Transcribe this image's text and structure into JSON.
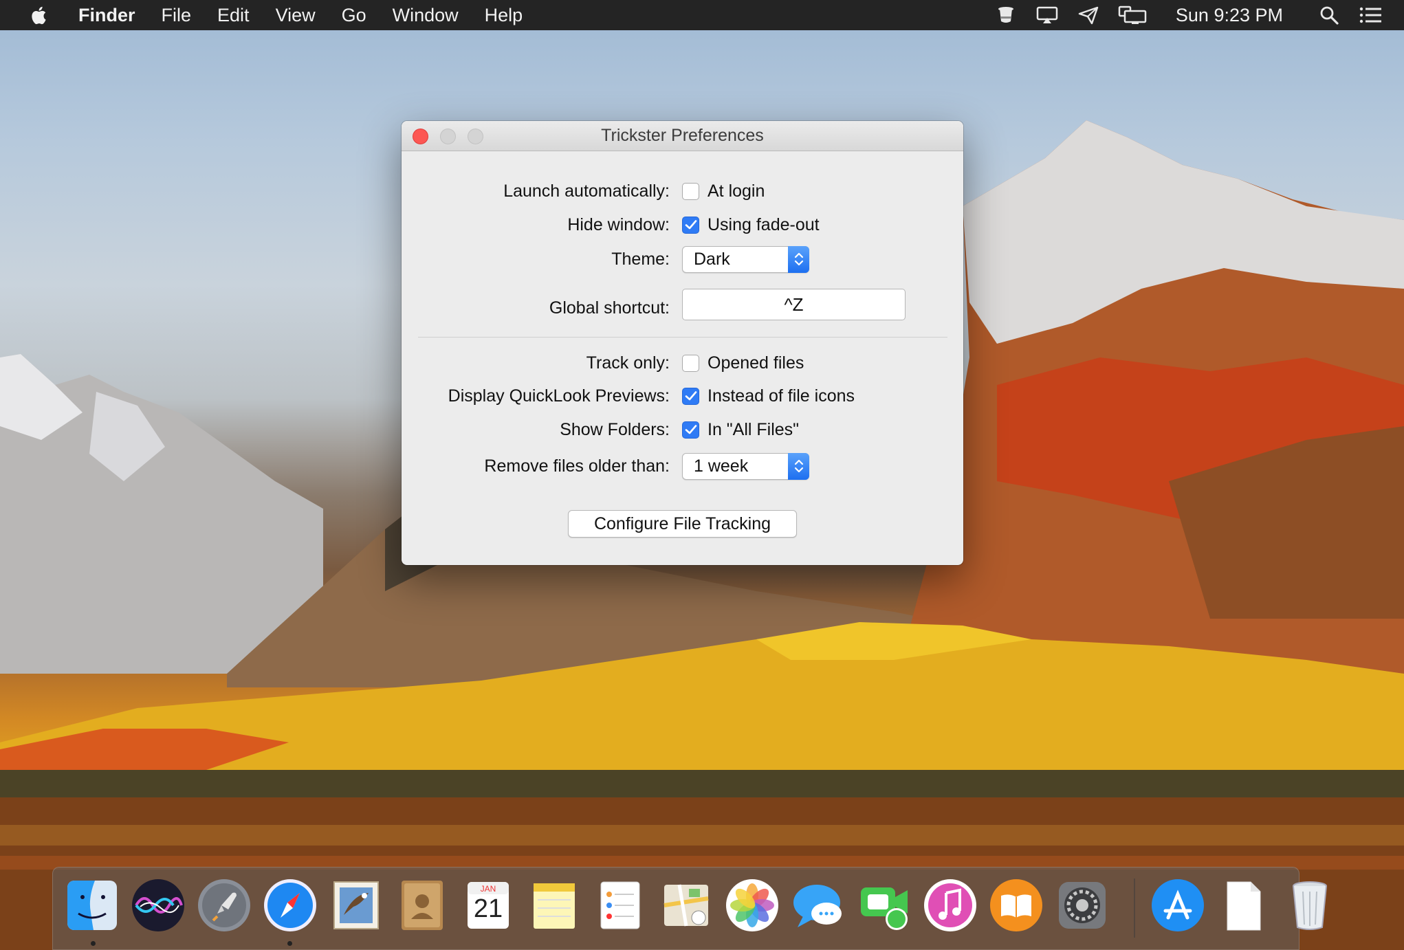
{
  "menubar": {
    "app_name": "Finder",
    "menus": [
      "File",
      "Edit",
      "View",
      "Go",
      "Window",
      "Help"
    ],
    "clock": "Sun 9:23 PM",
    "status_icons": [
      "top-hat-icon",
      "screen-share-icon",
      "send-icon",
      "displays-icon",
      "search-icon",
      "list-icon"
    ]
  },
  "window": {
    "title": "Trickster Preferences",
    "launch": {
      "label": "Launch automatically:",
      "option": "At login",
      "checked": false
    },
    "hide": {
      "label": "Hide window:",
      "option": "Using fade-out",
      "checked": true
    },
    "theme": {
      "label": "Theme:",
      "value": "Dark"
    },
    "shortcut": {
      "label": "Global shortcut:",
      "value": "^Z"
    },
    "track": {
      "label": "Track only:",
      "option": "Opened files",
      "checked": false
    },
    "quicklook": {
      "label": "Display QuickLook Previews:",
      "option": "Instead of file icons",
      "checked": true
    },
    "folders": {
      "label": "Show Folders:",
      "option": "In \"All Files\"",
      "checked": true
    },
    "remove": {
      "label": "Remove files older than:",
      "value": "1 week"
    },
    "configure_button": "Configure File Tracking"
  },
  "dock": {
    "calendar_month": "JAN",
    "calendar_day": "21",
    "apps": [
      "Finder",
      "Siri",
      "Launchpad",
      "Safari",
      "Mail",
      "Contacts",
      "Calendar",
      "Notes",
      "Reminders",
      "Maps",
      "Photos",
      "Messages",
      "FaceTime",
      "iTunes",
      "iBooks",
      "System Preferences",
      "App Store",
      "Document",
      "Trash"
    ],
    "running": [
      "Finder",
      "Safari"
    ]
  },
  "colors": {
    "accent": "#2f7bf5",
    "close_button": "#fc5753",
    "menubar": "#242424"
  }
}
